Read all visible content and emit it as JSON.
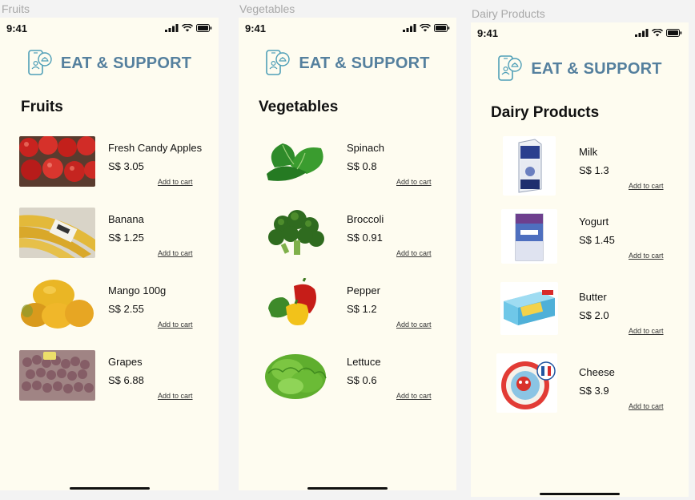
{
  "frames": [
    {
      "label": "Fruits",
      "time": "9:41",
      "brand": "EAT & SUPPORT",
      "title": "Fruits",
      "items": [
        {
          "name": "Fresh Candy Apples",
          "price": "S$ 3.05",
          "cart": "Add to cart",
          "icon": "apples-image"
        },
        {
          "name": "Banana",
          "price": "S$ 1.25",
          "cart": "Add to cart",
          "icon": "banana-image"
        },
        {
          "name": "Mango 100g",
          "price": "S$ 2.55",
          "cart": "Add to cart",
          "icon": "mango-image"
        },
        {
          "name": "Grapes",
          "price": "S$ 6.88",
          "cart": "Add to cart",
          "icon": "grapes-image"
        }
      ]
    },
    {
      "label": "Vegetables",
      "time": "9:41",
      "brand": "EAT & SUPPORT",
      "title": "Vegetables",
      "items": [
        {
          "name": "Spinach",
          "price": "S$ 0.8",
          "cart": "Add to cart",
          "icon": "spinach-image"
        },
        {
          "name": "Broccoli",
          "price": "S$ 0.91",
          "cart": "Add to cart",
          "icon": "broccoli-image"
        },
        {
          "name": "Pepper",
          "price": "S$ 1.2",
          "cart": "Add to cart",
          "icon": "pepper-image"
        },
        {
          "name": "Lettuce",
          "price": "S$ 0.6",
          "cart": "Add to cart",
          "icon": "lettuce-image"
        }
      ]
    },
    {
      "label": "Dairy Products",
      "time": "9:41",
      "brand": "EAT & SUPPORT",
      "title": "Dairy Products",
      "items": [
        {
          "name": "Milk",
          "price": "S$ 1.3",
          "cart": "Add to cart",
          "icon": "milk-carton-image"
        },
        {
          "name": "Yogurt",
          "price": "S$ 1.45",
          "cart": "Add to cart",
          "icon": "yogurt-carton-image"
        },
        {
          "name": "Butter",
          "price": "S$ 2.0",
          "cart": "Add to cart",
          "icon": "butter-box-image"
        },
        {
          "name": "Cheese",
          "price": "S$ 3.9",
          "cart": "Add to cart",
          "icon": "cheese-box-image"
        }
      ]
    }
  ]
}
